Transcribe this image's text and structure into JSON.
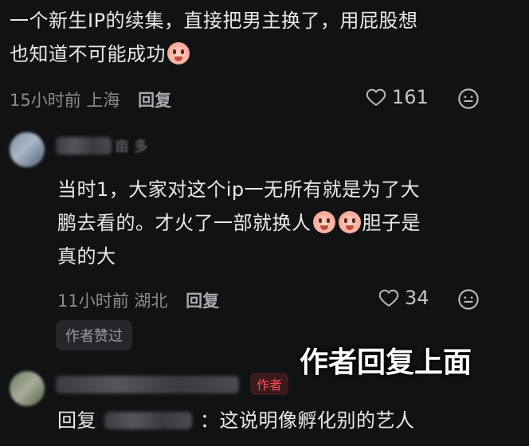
{
  "comment1": {
    "text_line1": "一个新生IP的续集，直接把男主换了，用屁股想",
    "text_line2": "也知道不可能成功",
    "time_location": "15小时前 上海",
    "reply_label": "回复",
    "likes": "161"
  },
  "comment2": {
    "username_hint": "亩 多",
    "text_line1": "当时1，大家对这个ip一无所有就是为了大",
    "text_line2a": "鹏去看的。才火了一部就换人",
    "text_line2b": "胆子是",
    "text_line3": "真的大",
    "time_location": "11小时前 湖北",
    "reply_label": "回复",
    "likes": "34",
    "liked_by_author_badge": "作者赞过"
  },
  "overlay_caption": "作者回复上面",
  "comment3": {
    "author_tag": "作者",
    "reply_prefix": "回复",
    "text": "：这说明像孵化别的艺人"
  },
  "icons": {
    "like": "heart-outline-icon",
    "emote": "smile-face-icon",
    "emoji": "crying-face-emoji"
  }
}
